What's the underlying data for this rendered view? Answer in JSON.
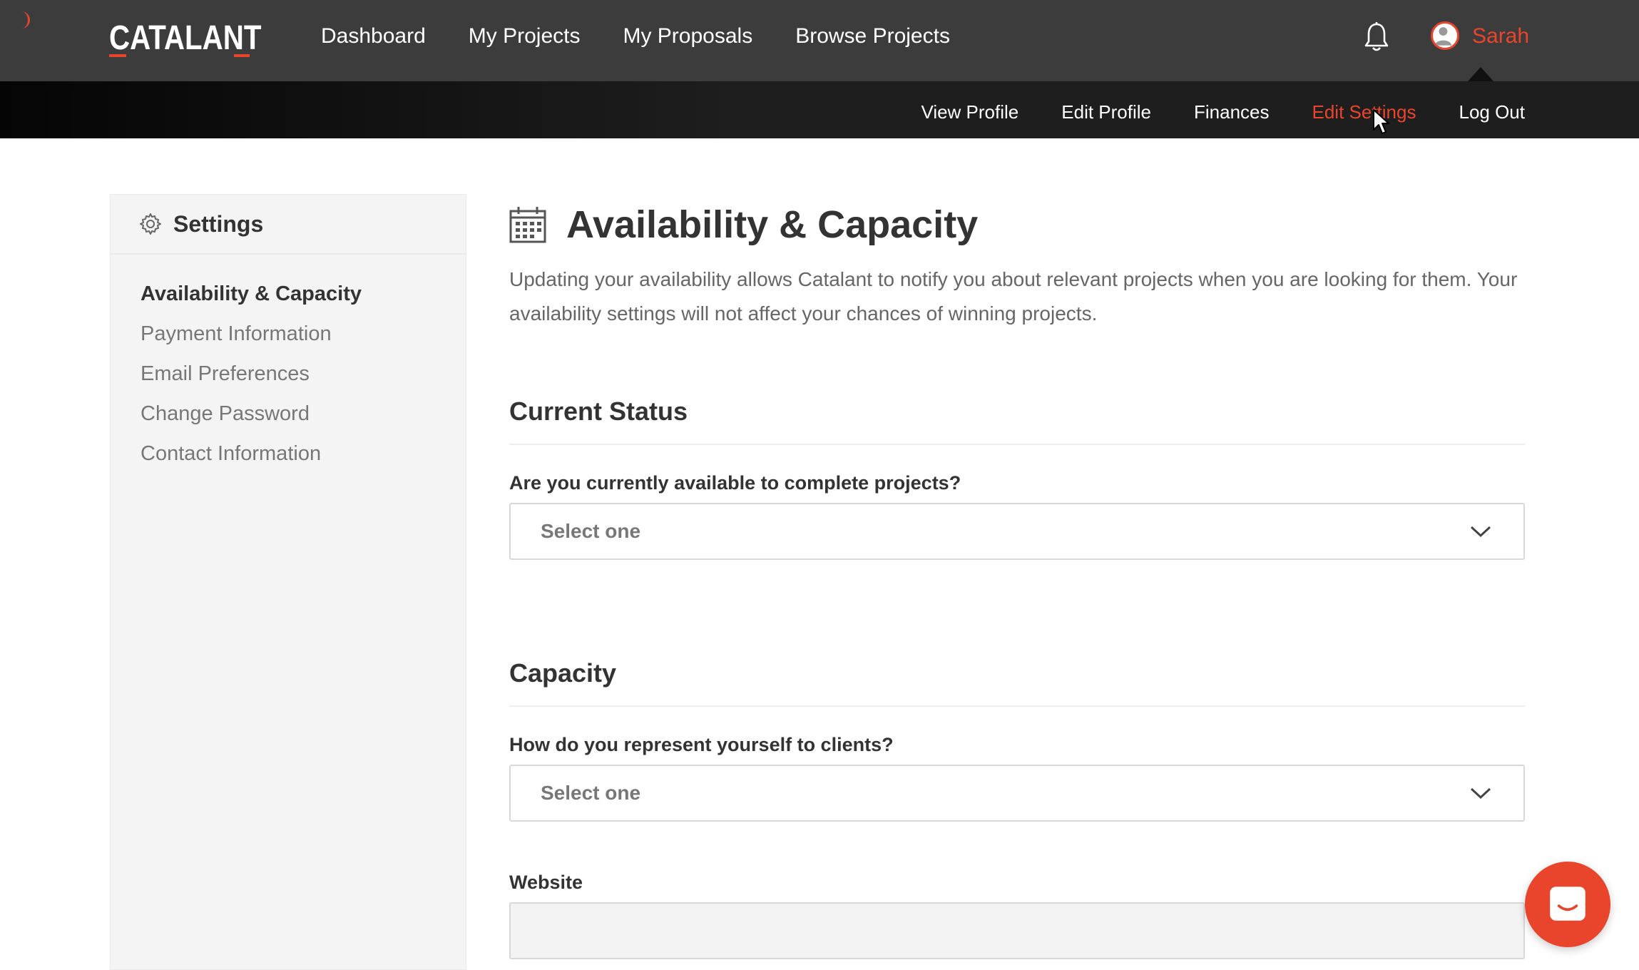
{
  "brand": {
    "name": "CATALANT",
    "accent_color": "#e8452c"
  },
  "nav": {
    "items": [
      {
        "label": "Dashboard"
      },
      {
        "label": "My Projects"
      },
      {
        "label": "My Proposals"
      },
      {
        "label": "Browse Projects"
      }
    ],
    "user_name": "Sarah",
    "icons": [
      "bell-icon",
      "user-avatar-icon"
    ]
  },
  "subnav": {
    "items": [
      {
        "label": "View Profile",
        "active": false
      },
      {
        "label": "Edit Profile",
        "active": false
      },
      {
        "label": "Finances",
        "active": false
      },
      {
        "label": "Edit Settings",
        "active": true
      },
      {
        "label": "Log Out",
        "active": false
      }
    ]
  },
  "sidebar": {
    "title": "Settings",
    "icon": "gear-icon",
    "items": [
      {
        "label": "Availability & Capacity",
        "active": true
      },
      {
        "label": "Payment Information",
        "active": false
      },
      {
        "label": "Email Preferences",
        "active": false
      },
      {
        "label": "Change Password",
        "active": false
      },
      {
        "label": "Contact Information",
        "active": false
      }
    ]
  },
  "main": {
    "icon": "calendar-icon",
    "title": "Availability & Capacity",
    "intro": "Updating your availability allows Catalant to notify you about relevant projects when you are looking for them. Your availability settings will not affect your chances of winning projects.",
    "sections": {
      "status": {
        "title": "Current Status",
        "question": "Are you currently available to complete projects?",
        "select_value": "Select one"
      },
      "capacity": {
        "title": "Capacity",
        "question": "How do you represent yourself to clients?",
        "select_value": "Select one",
        "website_label": "Website",
        "website_value": ""
      }
    }
  },
  "chat": {
    "icon": "chat-bubble-icon"
  }
}
